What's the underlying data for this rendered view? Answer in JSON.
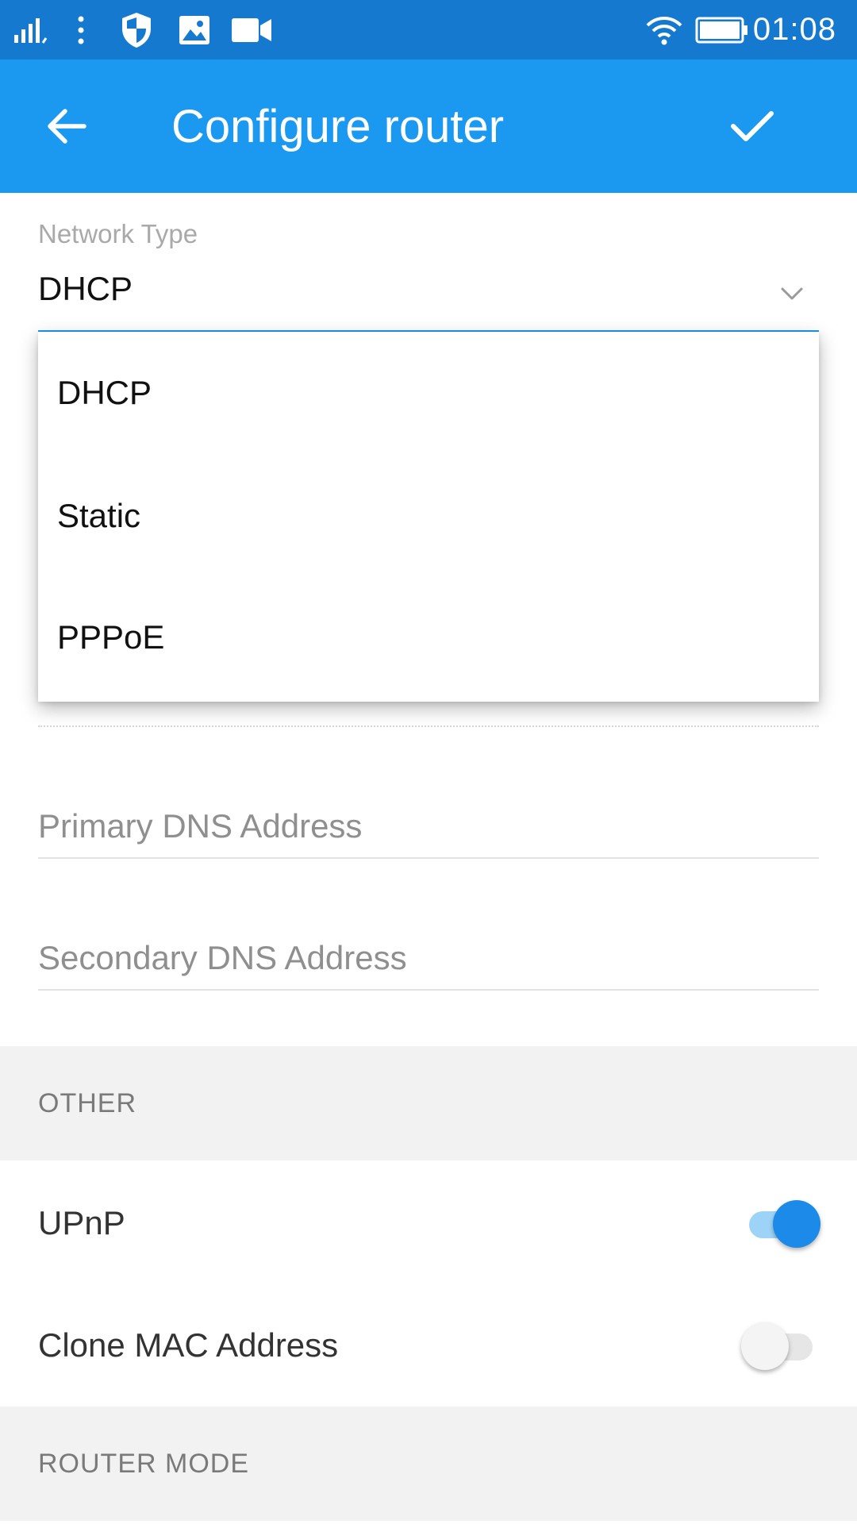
{
  "status_bar": {
    "time": "01:08",
    "icons": [
      "signal-icon",
      "more-vert-icon",
      "shield-icon",
      "image-icon",
      "video-camera-icon",
      "wifi-icon",
      "battery-icon"
    ]
  },
  "app_bar": {
    "title": "Configure router",
    "back_icon": "arrow-back-icon",
    "confirm_icon": "check-icon",
    "background": "#1b98f0"
  },
  "network_type": {
    "label": "Network Type",
    "value": "DHCP",
    "options": [
      "DHCP",
      "Static",
      "PPPoE"
    ]
  },
  "dns": {
    "primary_placeholder": "Primary DNS Address",
    "secondary_placeholder": "Secondary DNS Address"
  },
  "sections": {
    "other": "OTHER",
    "router_mode": "ROUTER MODE"
  },
  "toggles": {
    "upnp": {
      "label": "UPnP",
      "on": true
    },
    "clone_mac": {
      "label": "Clone MAC Address",
      "on": false
    }
  },
  "colors": {
    "status_bar": "#1679d0",
    "accent": "#1b98f0",
    "section_bg": "#f2f2f2"
  }
}
